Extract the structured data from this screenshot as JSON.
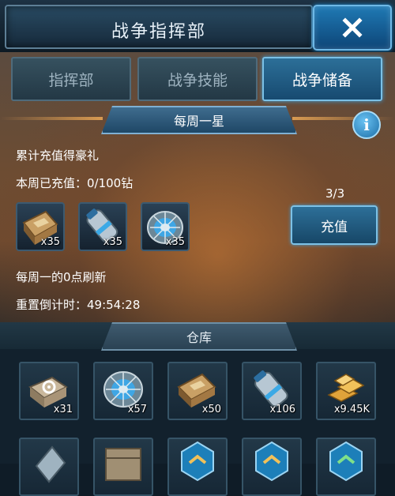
{
  "header": {
    "title": "战争指挥部",
    "close_icon": "close-icon"
  },
  "tabs": [
    {
      "label": "指挥部",
      "active": false
    },
    {
      "label": "战争技能",
      "active": false
    },
    {
      "label": "战争储备",
      "active": true
    }
  ],
  "event": {
    "banner": "每周一星",
    "info_icon": "info-icon",
    "reward_title": "累计充值得豪礼",
    "recharged": "本周已充值：0/100钻",
    "progress": "3/3",
    "recharge_button": "充值",
    "rewards": [
      {
        "icon": "resource-box-icon",
        "qty": "x35"
      },
      {
        "icon": "energy-canister-icon",
        "qty": "x35"
      },
      {
        "icon": "turbine-core-icon",
        "qty": "x35"
      }
    ],
    "refresh_note": "每周一的0点刷新",
    "countdown": "重置倒计时：49:54:28"
  },
  "warehouse": {
    "title": "仓库",
    "items": [
      {
        "icon": "gear-box-icon",
        "qty": "x31"
      },
      {
        "icon": "turbine-core-icon",
        "qty": "x57"
      },
      {
        "icon": "resource-box-icon",
        "qty": "x50"
      },
      {
        "icon": "energy-canister-icon",
        "qty": "x106"
      },
      {
        "icon": "gold-bars-icon",
        "qty": "x9.45K"
      },
      {
        "icon": "steel-ingot-icon",
        "qty": ""
      },
      {
        "icon": "supply-crate-icon",
        "qty": ""
      },
      {
        "icon": "rank-badge-icon",
        "qty": ""
      },
      {
        "icon": "rank-badge-icon",
        "qty": ""
      },
      {
        "icon": "rank-badge-icon",
        "qty": ""
      }
    ]
  },
  "colors": {
    "accent_blue": "#1f79b4",
    "panel_brown": "#6d4c32",
    "dark_bg": "#0f1c27"
  }
}
